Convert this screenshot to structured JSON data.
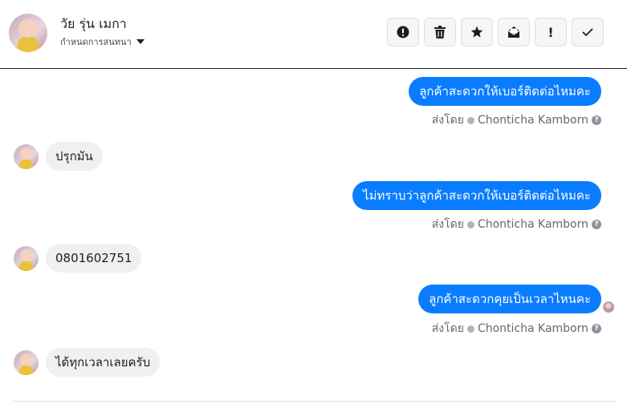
{
  "header": {
    "contact_name": "วัย รุ่น เมกา",
    "subtitle": "กำหนดการสนทนา",
    "actions": [
      {
        "name": "spam-button",
        "icon": "exclamation-circle-icon",
        "glyph": "!"
      },
      {
        "name": "delete-button",
        "icon": "trash-icon",
        "glyph": ""
      },
      {
        "name": "star-button",
        "icon": "star-icon",
        "glyph": "★"
      },
      {
        "name": "mark-unread-button",
        "icon": "envelope-icon",
        "glyph": ""
      },
      {
        "name": "important-button",
        "icon": "exclamation-icon",
        "glyph": "!"
      },
      {
        "name": "done-button",
        "icon": "check-icon",
        "glyph": "✓"
      }
    ]
  },
  "messages": [
    {
      "direction": "out",
      "text": "ลูกค้าสะดวกให้เบอร์ติดต่อไหมคะ",
      "sent_by_label": "ส่งโดย",
      "sender": "Chonticha Kamborn"
    },
    {
      "direction": "in",
      "text": "ปรุกมัน"
    },
    {
      "direction": "out",
      "text": "ไม่ทราบว่าลูกค้าสะดวกให้เบอร์ติดต่อไหมคะ",
      "sent_by_label": "ส่งโดย",
      "sender": "Chonticha Kamborn"
    },
    {
      "direction": "in",
      "text": "0801602751"
    },
    {
      "direction": "out",
      "text": "ลูกค้าสะดวกคุยเป็นเวลาไหนคะ",
      "sent_by_label": "ส่งโดย",
      "sender": "Chonticha Kamborn",
      "seen": true
    },
    {
      "direction": "in",
      "text": "ได้ทุกเวลาเลยครับ"
    }
  ],
  "colors": {
    "outgoing_bubble": "#0a7cff",
    "incoming_bubble": "#f0f0f0",
    "meta_text": "#65676b"
  }
}
